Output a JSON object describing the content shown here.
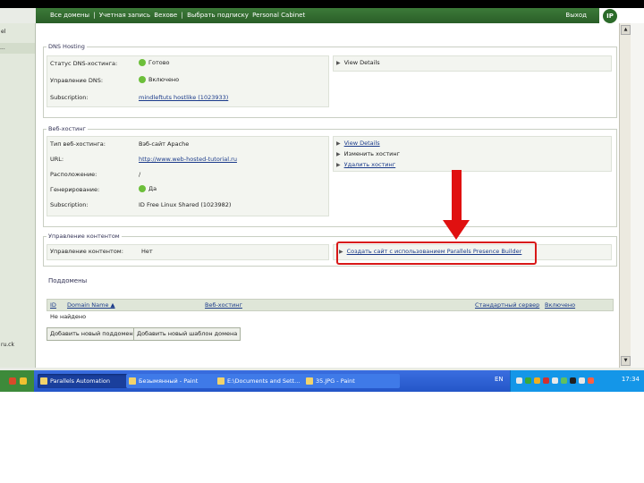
{
  "topnav": {
    "links": [
      "Все домены",
      "|",
      "Учетная запись",
      "Вехове",
      "|",
      "Выбрать подписку",
      "Personal Cabinet"
    ],
    "logout": "Выход"
  },
  "logo": {
    "mark": "IP",
    "text": ""
  },
  "left": {
    "item1": "el",
    "item2": "...",
    "footer": "ru.ck"
  },
  "dns": {
    "title": "DNS Hosting",
    "rows": [
      {
        "label": "Статус DNS-хостинга:",
        "value": "Готово",
        "status": "green"
      },
      {
        "label": "Управление DNS:",
        "value": "Включено",
        "status": "green"
      },
      {
        "label": "Subscription:",
        "value": "mindleftuts hostlike (1023933)"
      }
    ],
    "action": "View Details"
  },
  "webhosting": {
    "title": "Веб-хостинг",
    "rows": [
      {
        "label": "Тип веб-хостинга:",
        "value": "Вэб-сайт Apache"
      },
      {
        "label": "URL:",
        "value": "http://www.web-hosted-tutorial.ru"
      },
      {
        "label": "Расположение:",
        "value": "/"
      },
      {
        "label": "Генерирование:",
        "value": "Да",
        "status": "green"
      },
      {
        "label": "Subscription:",
        "value": "ID Free Linux Shared (1023982)"
      }
    ],
    "actions": [
      "View Details",
      "Изменить хостинг",
      "Удалить хостинг"
    ]
  },
  "content_mgmt": {
    "title": "Управление контентом",
    "label": "Управление контентом:",
    "value": "Нет",
    "action": "Создать сайт с использованием Parallels Presence Builder"
  },
  "subdomains": {
    "title": "Поддомены",
    "columns": [
      "ID",
      "Domain Name ▲",
      "Веб-хостинг",
      "Стандартный сервер",
      "Включено"
    ],
    "empty": "Не найдено",
    "buttons": [
      "Добавить новый поддомен",
      "Добавить новый шаблон домена"
    ]
  },
  "taskbar": {
    "tasks": [
      "Parallels Automation",
      "Безымянный - Paint",
      "E:\\Documents and Sett...",
      "35.JPG - Paint"
    ],
    "lang": "EN",
    "clock": "17:34"
  },
  "colors": {
    "nav": "#2f6a2c",
    "highlight": "#d81818",
    "taskbar": "#2456c8",
    "status_ok": "#6cbf3a"
  }
}
